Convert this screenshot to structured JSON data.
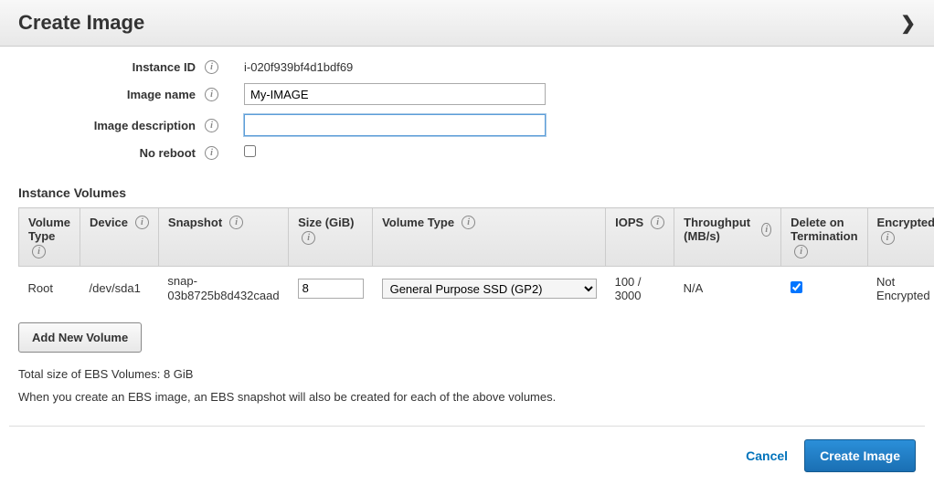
{
  "header": {
    "title": "Create Image"
  },
  "form": {
    "instance_id_label": "Instance ID",
    "instance_id_value": "i-020f939bf4d1bdf69",
    "image_name_label": "Image name",
    "image_name_value": "My-IMAGE",
    "image_desc_label": "Image description",
    "image_desc_value": "",
    "no_reboot_label": "No reboot",
    "no_reboot_checked": false
  },
  "volumes_section_title": "Instance Volumes",
  "columns": {
    "vol_type_short": "Volume Type",
    "device": "Device",
    "snapshot": "Snapshot",
    "size": "Size (GiB)",
    "vol_type": "Volume Type",
    "iops": "IOPS",
    "throughput": "Throughput (MB/s)",
    "delete_on_term": "Delete on Termination",
    "encrypted": "Encrypted"
  },
  "rows": [
    {
      "vtype_short": "Root",
      "device": "/dev/sda1",
      "snapshot": "snap-03b8725b8d432caad",
      "size": "8",
      "vtype_option": "General Purpose SSD (GP2)",
      "iops": "100 / 3000",
      "throughput": "N/A",
      "delete_on_term": true,
      "encrypted": "Not Encrypted"
    }
  ],
  "add_volume_label": "Add New Volume",
  "summary_line1": "Total size of EBS Volumes: 8 GiB",
  "summary_line2": "When you create an EBS image, an EBS snapshot will also be created for each of the above volumes.",
  "footer": {
    "cancel": "Cancel",
    "create": "Create Image"
  }
}
